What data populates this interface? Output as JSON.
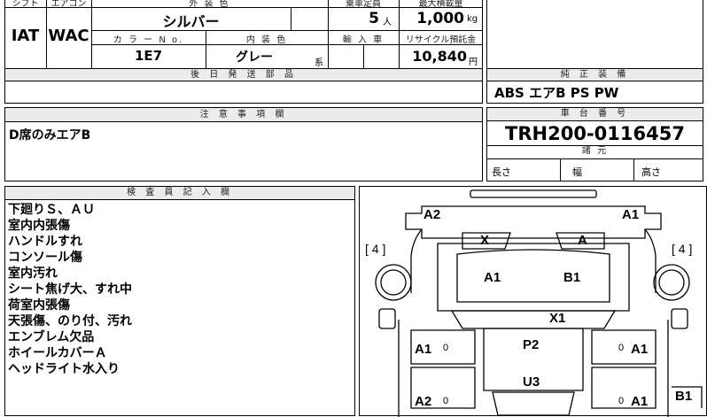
{
  "spec_header": {
    "col_shift": "シフト",
    "col_aircon": "エアコン",
    "col_exterior": "外 装 色",
    "col_capacity": "乗車定員",
    "col_loadmax": "最大積載量",
    "shift": "IAT",
    "aircon": "WAC",
    "exterior_color": "シルバー",
    "capacity": "5",
    "capacity_unit": "人",
    "load": "1,000",
    "load_unit": "kg",
    "col_color_no": "カ ラ ー N o.",
    "col_interior": "内 装 色",
    "col_import": "輸 入 車",
    "col_recycle": "リサイクル預託金",
    "color_no": "1E7",
    "interior_color": "グレー",
    "interior_suffix": "系",
    "recycle_fee": "10,840",
    "recycle_unit": "円"
  },
  "later_parts": {
    "header": "後 日 発 送 部 品",
    "value": ""
  },
  "genuine_equipment": {
    "header": "純 正 装 備",
    "value": "ABS エアB PS PW"
  },
  "notes": {
    "header": "注 意 事 項 欄",
    "value": "D席のみエアB"
  },
  "chassis": {
    "header": "車 台 番 号",
    "number": "TRH200-0116457",
    "dims_header": "諸 元",
    "length_label": "長さ",
    "width_label": "幅",
    "height_label": "高さ"
  },
  "inspector": {
    "header": "検 査 員 記 入 欄",
    "lines": [
      "下廻りＳ、ＡＵ",
      "室内内張傷",
      "ハンドルすれ",
      "コンソール傷",
      "室内汚れ",
      "シート焦げ大、すれ中",
      "荷室内張傷",
      "天張傷、のり付、汚れ",
      "エンブレム欠品",
      "ホイールカバーＡ",
      "ヘッドライト水入り"
    ]
  },
  "diagram": {
    "tire_left": "[ 4 ]",
    "tire_right": "[ 4 ]",
    "marks": {
      "front_left_corner": "A2",
      "front_right_corner": "A1",
      "headlight_left": "X",
      "headlight_right": "A",
      "hood_left": "A1",
      "hood_right": "B1",
      "windshield": "X1",
      "left_front_door": "A1",
      "right_front_door": "A1",
      "roof": "P2",
      "left_rear_door": "A2",
      "right_rear_door": "A1",
      "roof_rear": "U3",
      "rear_right_corner": "B1",
      "zero_marks": [
        "0",
        "0",
        "0",
        "0"
      ]
    }
  }
}
